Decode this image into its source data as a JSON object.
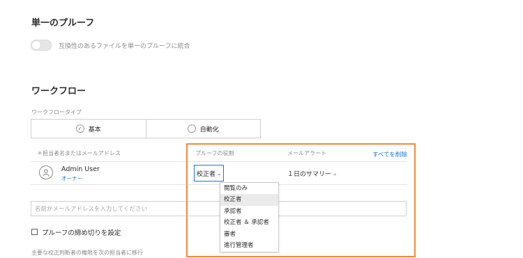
{
  "single_proof": {
    "title": "単一のプルーフ",
    "toggle_label": "互換性のあるファイルを単一のプルーフに統合"
  },
  "workflow": {
    "title": "ワークフロー",
    "type_label": "ワークフロータイプ",
    "options": [
      {
        "label": "基本",
        "selected": true
      },
      {
        "label": "自動化",
        "selected": false
      }
    ]
  },
  "table": {
    "col_assignee": "＊担当者名またはメールアドレス",
    "col_role": "プルーフの役割",
    "col_alert": "メールアラート",
    "remove_all": "すべてを削除",
    "row": {
      "name": "Admin User",
      "sub": "オーナー",
      "role": "校正者",
      "alert": "１日のサマリー"
    }
  },
  "role_menu": {
    "items": [
      "閲覧のみ",
      "校正者",
      "承認者",
      "校正者 ＆ 承認者",
      "審者",
      "進行管理者"
    ],
    "selected_index": 1
  },
  "add_input": {
    "placeholder": "名前かメールアドレスを入力してください"
  },
  "deadline": {
    "label": "プルーフの締め切りを設定"
  },
  "footer_text": "主要な校正判断者の権限を次の担当者に移行",
  "colors": {
    "accent": "#1473e6",
    "highlight": "#f28a3b"
  }
}
